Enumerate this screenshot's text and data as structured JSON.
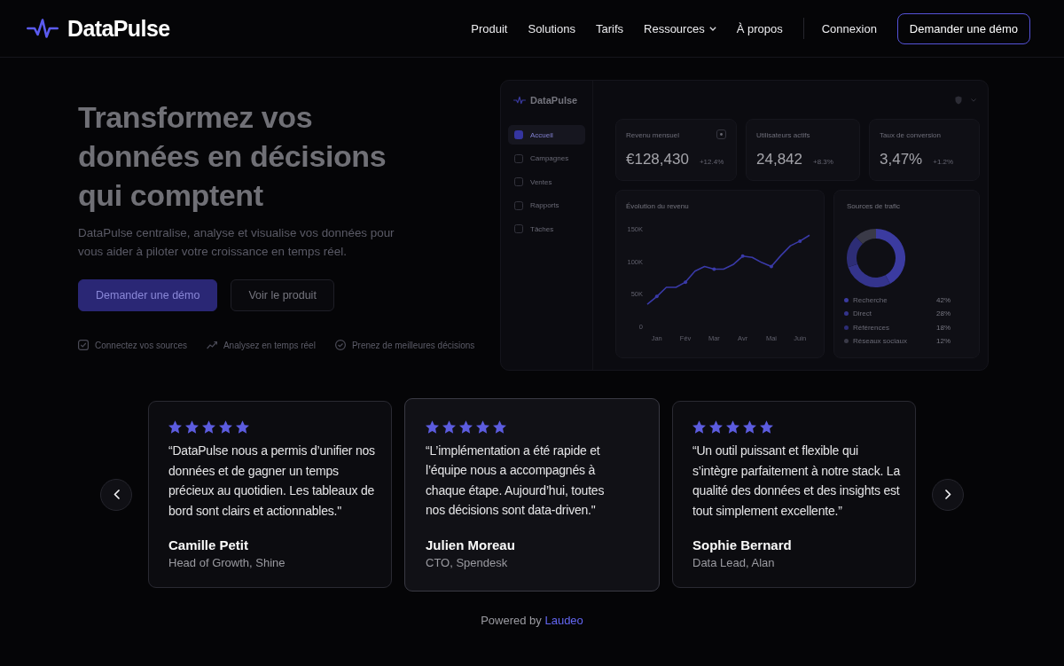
{
  "header": {
    "logo": "DataPulse",
    "nav": [
      {
        "label": "Produit",
        "has_menu": false
      },
      {
        "label": "Solutions",
        "has_menu": false
      },
      {
        "label": "Tarifs",
        "has_menu": false
      },
      {
        "label": "Ressources",
        "has_menu": true
      },
      {
        "label": "À propos",
        "has_menu": false
      }
    ],
    "login": "Connexion",
    "cta": "Demander une démo"
  },
  "hero": {
    "title": "Transformez vos données en décisions qui comptent",
    "subtitle": "DataPulse centralise, analyse et visualise vos données pour vous aider à piloter votre croissance en temps réel.",
    "buttons": [
      {
        "label": "Demander une démo",
        "kind": "primary"
      },
      {
        "label": "Voir le produit",
        "kind": "secondary"
      }
    ],
    "features": [
      "Connectez vos sources",
      "Analysez en temps réel",
      "Prenez de meilleures décisions"
    ]
  },
  "dashboard": {
    "logo": "DataPulse",
    "sidebar": [
      {
        "label": "Accueil",
        "selected": true
      },
      {
        "label": "Campagnes",
        "selected": false
      },
      {
        "label": "Ventes",
        "selected": false
      },
      {
        "label": "Rapports",
        "selected": false
      },
      {
        "label": "Tâches",
        "selected": false
      }
    ],
    "kpis": [
      {
        "label": "Revenu mensuel",
        "value": "€128,430",
        "change": "+12.4%",
        "action": true
      },
      {
        "label": "Utilisateurs actifs",
        "value": "24,842",
        "change": "+8.3%",
        "action": false
      },
      {
        "label": "Taux de conversion",
        "value": "3,47%",
        "change": "+1.2%",
        "action": false
      }
    ],
    "revenue": {
      "title": "Évolution du revenu",
      "chart_data": {
        "type": "line",
        "categories": [
          null,
          "Jan",
          null,
          null,
          "Fév",
          null,
          null,
          "Mar",
          null,
          null,
          "Avr",
          null,
          null,
          "Mai",
          null,
          null,
          "Juin",
          null
        ],
        "values": [
          34,
          46,
          60,
          60,
          68,
          85,
          92,
          88,
          88,
          95,
          108,
          106,
          98,
          92,
          109,
          124,
          131,
          140
        ],
        "ylim": [
          0,
          150
        ],
        "yticks": [
          {
            "value": 0,
            "label": "0"
          },
          {
            "value": 50,
            "label": "50K"
          },
          {
            "value": 100,
            "label": "100K"
          },
          {
            "value": 150,
            "label": "150K"
          }
        ]
      }
    },
    "traffic": {
      "title": "Sources de trafic",
      "chart_data": {
        "type": "donut",
        "categories": [
          "Recherche",
          "Direct",
          "Références",
          "Réseaux sociaux"
        ],
        "values": [
          42,
          28,
          18,
          12
        ]
      },
      "legend": [
        {
          "value": "42%",
          "color": "#3b3ba0"
        },
        {
          "value": "28%",
          "color": "#34348c"
        },
        {
          "value": "18%",
          "color": "#2d2d76"
        },
        {
          "value": "12%",
          "color": "#3a3a48"
        }
      ]
    }
  },
  "testimonials": [
    {
      "stars": 5,
      "quote": "“DataPulse nous a permis d’unifier nos données et de gagner un temps précieux au quotidien. Les tableaux de bord sont clairs et actionnables.\"",
      "name": "Camille Petit",
      "role": "Head of Growth, Shine",
      "selected": false
    },
    {
      "stars": 5,
      "quote": "“L’implémentation a été rapide et l’équipe nous a accompagnés à chaque étape. Aujourd’hui, toutes nos décisions sont data-driven.\"",
      "name": "Julien Moreau",
      "role": "CTO, Spendesk",
      "selected": true
    },
    {
      "stars": 5,
      "quote": "“Un outil puissant et flexible qui s’intègre parfaitement à notre stack. La qualité des données et des insights est tout simplement excellente.”",
      "name": "Sophie Bernard",
      "role": "Data Lead, Alan",
      "selected": false
    }
  ],
  "footer": {
    "text": "Powered by",
    "link": "Laudeo"
  }
}
